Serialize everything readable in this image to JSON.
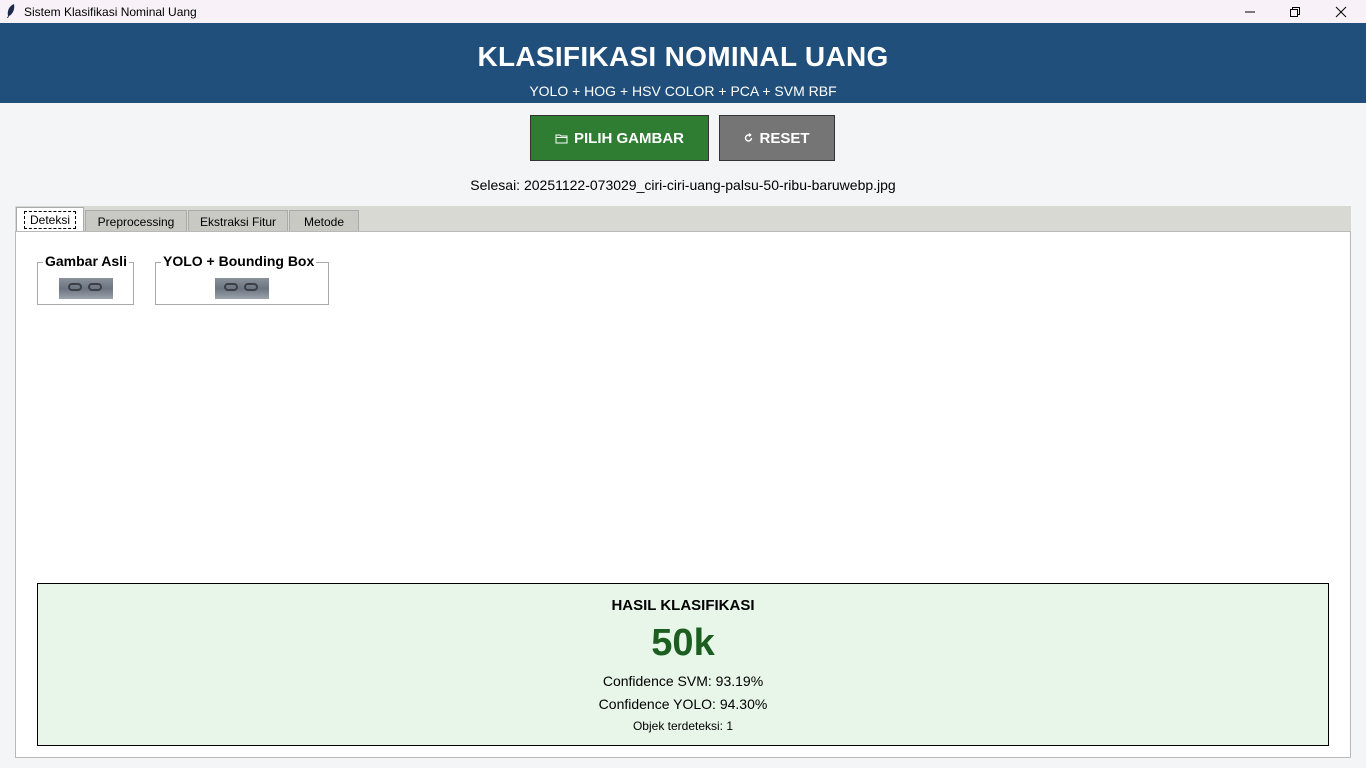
{
  "window": {
    "title": "Sistem Klasifikasi Nominal Uang",
    "controls": {
      "minimize": "minimize-icon",
      "maximize": "restore-icon",
      "close": "close-icon"
    }
  },
  "header": {
    "title": "KLASIFIKASI NOMINAL UANG",
    "subtitle": "YOLO + HOG + HSV COLOR + PCA + SVM RBF",
    "color": "#1f4f7a"
  },
  "toolbar": {
    "pilih_label": "PILIH GAMBAR",
    "pilih_icon": "folder-icon",
    "pilih_color": "#2e7d32",
    "reset_label": "RESET",
    "reset_icon": "refresh-icon",
    "reset_color": "#757575"
  },
  "status": "Selesai: 20251122-073029_ciri-ciri-uang-palsu-50-ribu-baruwebp.jpg",
  "tabs": [
    {
      "label": "Deteksi",
      "active": true
    },
    {
      "label": "Preprocessing",
      "active": false
    },
    {
      "label": "Ekstraksi Fitur",
      "active": false
    },
    {
      "label": "Metode",
      "active": false
    }
  ],
  "images": {
    "original_label": "Gambar Asli",
    "yolo_label": "YOLO + Bounding Box"
  },
  "result": {
    "title": "HASIL KLASIFIKASI",
    "value": "50k",
    "confidence_svm": "Confidence SVM: 93.19%",
    "confidence_yolo": "Confidence YOLO: 94.30%",
    "objects": "Objek terdeteksi: 1",
    "bg_color": "#e8f5e9",
    "value_color": "#1b5e20"
  }
}
